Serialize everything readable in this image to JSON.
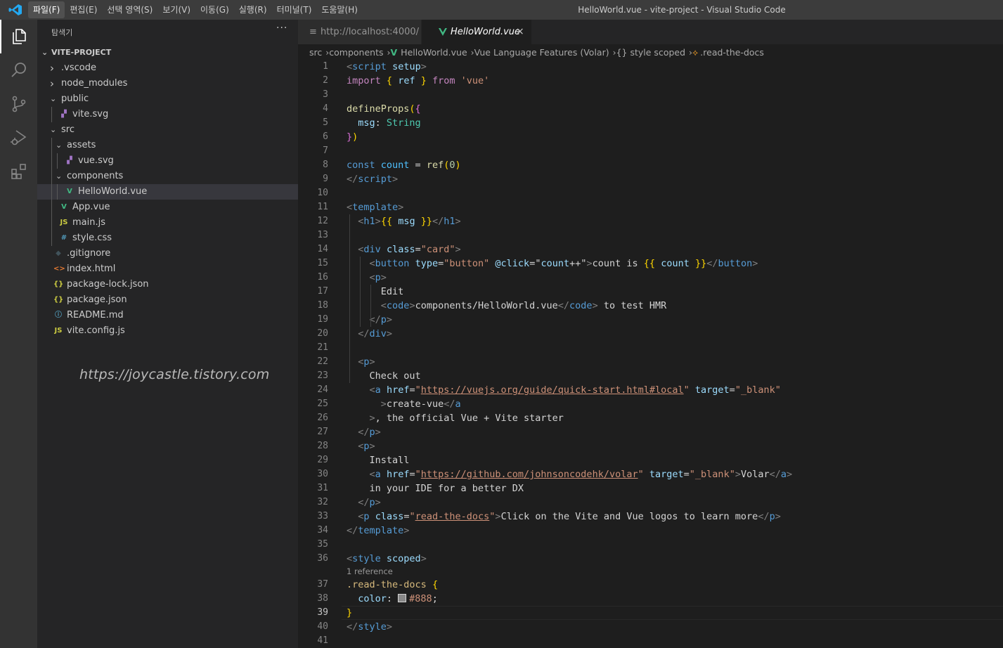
{
  "titlebar": {
    "menu": [
      "파일(F)",
      "편집(E)",
      "선택 영역(S)",
      "보기(V)",
      "이동(G)",
      "실행(R)",
      "터미널(T)",
      "도움말(H)"
    ],
    "window_title": "HelloWorld.vue - vite-project - Visual Studio Code"
  },
  "activitybar": {
    "items": [
      "explorer-icon",
      "search-icon",
      "source-control-icon",
      "run-debug-icon",
      "extensions-icon"
    ]
  },
  "sidebar": {
    "title": "탐색기",
    "more": "···",
    "project": "VITE-PROJECT",
    "tree": [
      {
        "label": ".vscode",
        "kind": "folder",
        "expanded": false,
        "depth": 0
      },
      {
        "label": "node_modules",
        "kind": "folder",
        "expanded": false,
        "depth": 0
      },
      {
        "label": "public",
        "kind": "folder",
        "expanded": true,
        "depth": 0
      },
      {
        "label": "vite.svg",
        "kind": "svg",
        "depth": 1
      },
      {
        "label": "src",
        "kind": "folder",
        "expanded": true,
        "depth": 0
      },
      {
        "label": "assets",
        "kind": "folder",
        "expanded": true,
        "depth": 1
      },
      {
        "label": "vue.svg",
        "kind": "svg",
        "depth": 2
      },
      {
        "label": "components",
        "kind": "folder",
        "expanded": true,
        "depth": 1
      },
      {
        "label": "HelloWorld.vue",
        "kind": "vue",
        "depth": 2,
        "selected": true
      },
      {
        "label": "App.vue",
        "kind": "vue",
        "depth": 1
      },
      {
        "label": "main.js",
        "kind": "js",
        "depth": 1
      },
      {
        "label": "style.css",
        "kind": "css",
        "depth": 1
      },
      {
        "label": ".gitignore",
        "kind": "git",
        "depth": 0
      },
      {
        "label": "index.html",
        "kind": "html",
        "depth": 0
      },
      {
        "label": "package-lock.json",
        "kind": "json",
        "depth": 0
      },
      {
        "label": "package.json",
        "kind": "json",
        "depth": 0
      },
      {
        "label": "README.md",
        "kind": "info",
        "depth": 0
      },
      {
        "label": "vite.config.js",
        "kind": "js",
        "depth": 0
      }
    ],
    "watermark": "https://joycastle.tistory.com"
  },
  "tabs": [
    {
      "label": "http://localhost:4000/",
      "icon": "preview-icon",
      "active": false
    },
    {
      "label": "HelloWorld.vue",
      "icon": "vue-icon",
      "active": true,
      "close": "×"
    }
  ],
  "breadcrumb": [
    "src",
    "components",
    "HelloWorld.vue",
    "Vue Language Features (Volar)",
    "{} style scoped",
    ".read-the-docs"
  ],
  "editor": {
    "active_line": 39,
    "codelens": {
      "before_line": 37,
      "text": "1 reference"
    },
    "lines": [
      [
        [
          "t-tag",
          "<"
        ],
        [
          "t-tname",
          "script"
        ],
        [
          "t-txt",
          " "
        ],
        [
          "t-attr",
          "setup"
        ],
        [
          "t-tag",
          ">"
        ]
      ],
      [
        [
          "t-kw",
          "import"
        ],
        [
          "t-txt",
          " "
        ],
        [
          "t-br1",
          "{"
        ],
        [
          "t-txt",
          " "
        ],
        [
          "t-prop",
          "ref"
        ],
        [
          "t-txt",
          " "
        ],
        [
          "t-br1",
          "}"
        ],
        [
          "t-txt",
          " "
        ],
        [
          "t-kw",
          "from"
        ],
        [
          "t-txt",
          " "
        ],
        [
          "t-str",
          "'vue'"
        ]
      ],
      [],
      [
        [
          "t-fn",
          "defineProps"
        ],
        [
          "t-br1",
          "("
        ],
        [
          "t-br2",
          "{"
        ]
      ],
      [
        [
          "t-txt",
          "  "
        ],
        [
          "t-prop",
          "msg"
        ],
        [
          "t-txt",
          ": "
        ],
        [
          "t-type",
          "String"
        ]
      ],
      [
        [
          "t-br2",
          "}"
        ],
        [
          "t-br1",
          ")"
        ]
      ],
      [],
      [
        [
          "t-kw2",
          "const"
        ],
        [
          "t-txt",
          " "
        ],
        [
          "t-var",
          "count"
        ],
        [
          "t-txt",
          " = "
        ],
        [
          "t-fn",
          "ref"
        ],
        [
          "t-br1",
          "("
        ],
        [
          "t-num",
          "0"
        ],
        [
          "t-br1",
          ")"
        ]
      ],
      [
        [
          "t-tag",
          "</"
        ],
        [
          "t-tname",
          "script"
        ],
        [
          "t-tag",
          ">"
        ]
      ],
      [],
      [
        [
          "t-tag",
          "<"
        ],
        [
          "t-tname",
          "template"
        ],
        [
          "t-tag",
          ">"
        ]
      ],
      [
        [
          "t-txt",
          "  "
        ],
        [
          "t-tag",
          "<"
        ],
        [
          "t-tname",
          "h1"
        ],
        [
          "t-tag",
          ">"
        ],
        [
          "t-br1",
          "{{"
        ],
        [
          "t-txt",
          " "
        ],
        [
          "t-prop",
          "msg"
        ],
        [
          "t-txt",
          " "
        ],
        [
          "t-br1",
          "}}"
        ],
        [
          "t-tag",
          "</"
        ],
        [
          "t-tname",
          "h1"
        ],
        [
          "t-tag",
          ">"
        ]
      ],
      [],
      [
        [
          "t-txt",
          "  "
        ],
        [
          "t-tag",
          "<"
        ],
        [
          "t-tname",
          "div"
        ],
        [
          "t-txt",
          " "
        ],
        [
          "t-attr",
          "class"
        ],
        [
          "t-txt",
          "="
        ],
        [
          "t-str",
          "\"card\""
        ],
        [
          "t-tag",
          ">"
        ]
      ],
      [
        [
          "t-txt",
          "    "
        ],
        [
          "t-tag",
          "<"
        ],
        [
          "t-tname",
          "button"
        ],
        [
          "t-txt",
          " "
        ],
        [
          "t-attr",
          "type"
        ],
        [
          "t-txt",
          "="
        ],
        [
          "t-str",
          "\"button\""
        ],
        [
          "t-txt",
          " "
        ],
        [
          "t-attr",
          "@click"
        ],
        [
          "t-txt",
          "="
        ],
        [
          "t-txt",
          "\""
        ],
        [
          "t-prop",
          "count"
        ],
        [
          "t-txt",
          "++\""
        ],
        [
          "t-tag",
          ">"
        ],
        [
          "t-txt",
          "count is "
        ],
        [
          "t-br1",
          "{{"
        ],
        [
          "t-txt",
          " "
        ],
        [
          "t-prop",
          "count"
        ],
        [
          "t-txt",
          " "
        ],
        [
          "t-br1",
          "}}"
        ],
        [
          "t-tag",
          "</"
        ],
        [
          "t-tname",
          "button"
        ],
        [
          "t-tag",
          ">"
        ]
      ],
      [
        [
          "t-txt",
          "    "
        ],
        [
          "t-tag",
          "<"
        ],
        [
          "t-tname",
          "p"
        ],
        [
          "t-tag",
          ">"
        ]
      ],
      [
        [
          "t-txt",
          "      Edit"
        ]
      ],
      [
        [
          "t-txt",
          "      "
        ],
        [
          "t-tag",
          "<"
        ],
        [
          "t-tname",
          "code"
        ],
        [
          "t-tag",
          ">"
        ],
        [
          "t-txt",
          "components/HelloWorld.vue"
        ],
        [
          "t-tag",
          "</"
        ],
        [
          "t-tname",
          "code"
        ],
        [
          "t-tag",
          ">"
        ],
        [
          "t-txt",
          " to test HMR"
        ]
      ],
      [
        [
          "t-txt",
          "    "
        ],
        [
          "t-tag",
          "</"
        ],
        [
          "t-tname",
          "p"
        ],
        [
          "t-tag",
          ">"
        ]
      ],
      [
        [
          "t-txt",
          "  "
        ],
        [
          "t-tag",
          "</"
        ],
        [
          "t-tname",
          "div"
        ],
        [
          "t-tag",
          ">"
        ]
      ],
      [],
      [
        [
          "t-txt",
          "  "
        ],
        [
          "t-tag",
          "<"
        ],
        [
          "t-tname",
          "p"
        ],
        [
          "t-tag",
          ">"
        ]
      ],
      [
        [
          "t-txt",
          "    Check out"
        ]
      ],
      [
        [
          "t-txt",
          "    "
        ],
        [
          "t-tag",
          "<"
        ],
        [
          "t-tname",
          "a"
        ],
        [
          "t-txt",
          " "
        ],
        [
          "t-attr",
          "href"
        ],
        [
          "t-txt",
          "="
        ],
        [
          "t-str",
          "\""
        ],
        [
          "t-link",
          "https://vuejs.org/guide/quick-start.html#local"
        ],
        [
          "t-str",
          "\""
        ],
        [
          "t-txt",
          " "
        ],
        [
          "t-attr",
          "target"
        ],
        [
          "t-txt",
          "="
        ],
        [
          "t-str",
          "\"_blank\""
        ]
      ],
      [
        [
          "t-txt",
          "      "
        ],
        [
          "t-tag",
          ">"
        ],
        [
          "t-txt",
          "create-vue"
        ],
        [
          "t-tag",
          "</"
        ],
        [
          "t-tname",
          "a"
        ]
      ],
      [
        [
          "t-txt",
          "    "
        ],
        [
          "t-tag",
          ">"
        ],
        [
          "t-txt",
          ", the official Vue + Vite starter"
        ]
      ],
      [
        [
          "t-txt",
          "  "
        ],
        [
          "t-tag",
          "</"
        ],
        [
          "t-tname",
          "p"
        ],
        [
          "t-tag",
          ">"
        ]
      ],
      [
        [
          "t-txt",
          "  "
        ],
        [
          "t-tag",
          "<"
        ],
        [
          "t-tname",
          "p"
        ],
        [
          "t-tag",
          ">"
        ]
      ],
      [
        [
          "t-txt",
          "    Install"
        ]
      ],
      [
        [
          "t-txt",
          "    "
        ],
        [
          "t-tag",
          "<"
        ],
        [
          "t-tname",
          "a"
        ],
        [
          "t-txt",
          " "
        ],
        [
          "t-attr",
          "href"
        ],
        [
          "t-txt",
          "="
        ],
        [
          "t-str",
          "\""
        ],
        [
          "t-link",
          "https://github.com/johnsoncodehk/volar"
        ],
        [
          "t-str",
          "\""
        ],
        [
          "t-txt",
          " "
        ],
        [
          "t-attr",
          "target"
        ],
        [
          "t-txt",
          "="
        ],
        [
          "t-str",
          "\"_blank\""
        ],
        [
          "t-tag",
          ">"
        ],
        [
          "t-txt",
          "Volar"
        ],
        [
          "t-tag",
          "</"
        ],
        [
          "t-tname",
          "a"
        ],
        [
          "t-tag",
          ">"
        ]
      ],
      [
        [
          "t-txt",
          "    in your IDE for a better DX"
        ]
      ],
      [
        [
          "t-txt",
          "  "
        ],
        [
          "t-tag",
          "</"
        ],
        [
          "t-tname",
          "p"
        ],
        [
          "t-tag",
          ">"
        ]
      ],
      [
        [
          "t-txt",
          "  "
        ],
        [
          "t-tag",
          "<"
        ],
        [
          "t-tname",
          "p"
        ],
        [
          "t-txt",
          " "
        ],
        [
          "t-attr",
          "class"
        ],
        [
          "t-txt",
          "="
        ],
        [
          "t-str",
          "\""
        ],
        [
          "t-link",
          "read-the-docs"
        ],
        [
          "t-str",
          "\""
        ],
        [
          "t-tag",
          ">"
        ],
        [
          "t-txt",
          "Click on the Vite and Vue logos to learn more"
        ],
        [
          "t-tag",
          "</"
        ],
        [
          "t-tname",
          "p"
        ],
        [
          "t-tag",
          ">"
        ]
      ],
      [
        [
          "t-tag",
          "</"
        ],
        [
          "t-tname",
          "template"
        ],
        [
          "t-tag",
          ">"
        ]
      ],
      [],
      [
        [
          "t-tag",
          "<"
        ],
        [
          "t-tname",
          "style"
        ],
        [
          "t-txt",
          " "
        ],
        [
          "t-attr",
          "scoped"
        ],
        [
          "t-tag",
          ">"
        ]
      ],
      [
        [
          "t-cls",
          ".read-the-docs"
        ],
        [
          "t-txt",
          " "
        ],
        [
          "t-br1",
          "{"
        ]
      ],
      [
        [
          "t-txt",
          "  "
        ],
        [
          "t-prop",
          "color"
        ],
        [
          "t-txt",
          ": "
        ],
        [
          "swatch",
          ""
        ],
        [
          "t-str",
          "#888"
        ],
        [
          "t-txt",
          ";"
        ]
      ],
      [
        [
          "t-br1",
          "}"
        ]
      ],
      [
        [
          "t-tag",
          "</"
        ],
        [
          "t-tname",
          "style"
        ],
        [
          "t-tag",
          ">"
        ]
      ],
      []
    ]
  },
  "colors": {
    "vue": "#41b883",
    "svg": "#a074c4",
    "js": "#cbcb41",
    "css": "#519aba",
    "html": "#e37933",
    "json": "#cbcb41",
    "info": "#519aba",
    "git": "#41535b"
  }
}
